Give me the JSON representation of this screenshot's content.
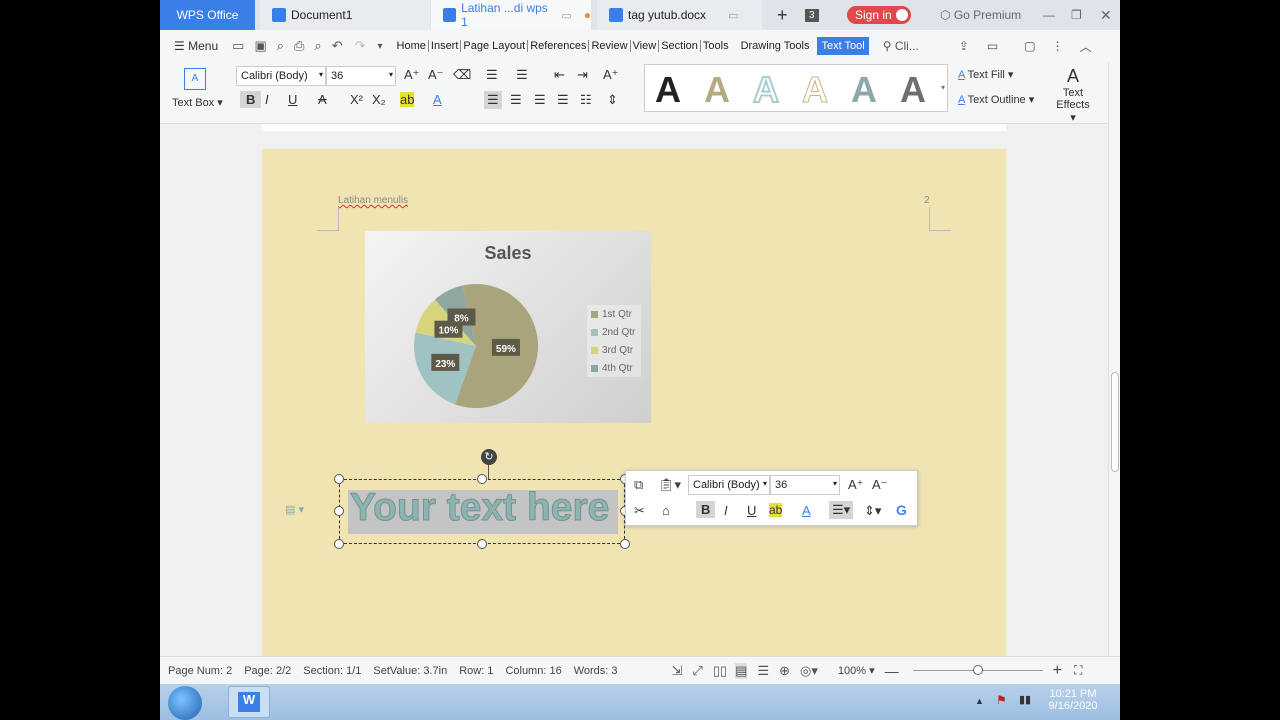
{
  "titlebar": {
    "app_tab": "WPS Office",
    "tabs": [
      "Document1",
      "Latihan ...di wps 1",
      "tag yutub.docx"
    ],
    "tab_count": "3",
    "sign_in": "Sign in",
    "go_premium": "Go Premium"
  },
  "menubar": {
    "menu_label": "Menu",
    "items": [
      "Home",
      "Insert",
      "Page Layout",
      "References",
      "Review",
      "View",
      "Section",
      "Tools",
      "Drawing Tools"
    ],
    "active_item": "Text Tool",
    "search": "Cli..."
  },
  "ribbon": {
    "textbox_label": "Text Box",
    "font": "Calibri (Body)",
    "size": "36",
    "text_fill": "Text Fill",
    "text_outline": "Text Outline",
    "text_effects_1": "Text",
    "text_effects_2": "Effects",
    "styles": [
      {
        "letter": "A",
        "color": "#222222"
      },
      {
        "letter": "A",
        "color": "#b5aa80"
      },
      {
        "letter": "A",
        "color": "#a9cccc"
      },
      {
        "letter": "A",
        "color": "#ffffff"
      },
      {
        "letter": "A",
        "color": "#8fa7a7"
      },
      {
        "letter": "A",
        "color": "#6f6f6f"
      }
    ]
  },
  "page": {
    "header_text": "Latihan menulis",
    "page_number": "2"
  },
  "chart_data": {
    "type": "pie",
    "title": "Sales",
    "categories": [
      "1st Qtr",
      "2nd Qtr",
      "3rd Qtr",
      "4th Qtr"
    ],
    "values": [
      59,
      23,
      10,
      8
    ],
    "labels": [
      "59%",
      "23%",
      "10%",
      "8%"
    ],
    "colors": [
      "#a9a47c",
      "#9fc2c2",
      "#d7d47e",
      "#8fa7a0"
    ],
    "legend": "right"
  },
  "textbox": {
    "text": "Your text here"
  },
  "floatbar": {
    "font": "Calibri (Body)",
    "size": "36"
  },
  "statusbar": {
    "page_num": "Page Num: 2",
    "page": "Page: 2/2",
    "section": "Section: 1/1",
    "setvalue": "SetValue: 3.7in",
    "row": "Row: 1",
    "column": "Column: 16",
    "words": "Words: 3",
    "zoom": "100%"
  },
  "taskbar": {
    "time": "10:21 PM",
    "date": "9/16/2020"
  }
}
